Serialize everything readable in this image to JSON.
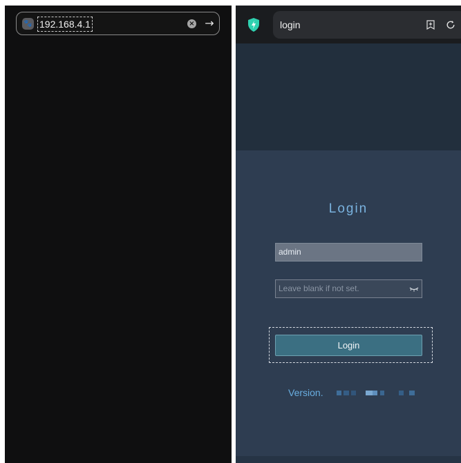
{
  "left_browser": {
    "url": "192.168.4.1",
    "site_icon": "paw-icon",
    "clear_icon": "clear-circle-icon",
    "go_icon": "arrow-right-icon"
  },
  "right_browser": {
    "url_text": "login",
    "shield_icon": "shield-lightning-icon",
    "bookmark_icon": "bookmark-plus-icon",
    "reload_icon": "reload-icon"
  },
  "login_form": {
    "title": "Login",
    "username_value": "admin",
    "password_placeholder": "Leave blank if not set.",
    "password_toggle_icon": "eye-closed-icon",
    "submit_label": "Login",
    "version_label": "Version."
  },
  "colors": {
    "accent_teal": "#3b6f82",
    "title_blue": "#7ab3df",
    "panel_bg": "#2e3d51",
    "dark_bg": "#0f0f10"
  }
}
